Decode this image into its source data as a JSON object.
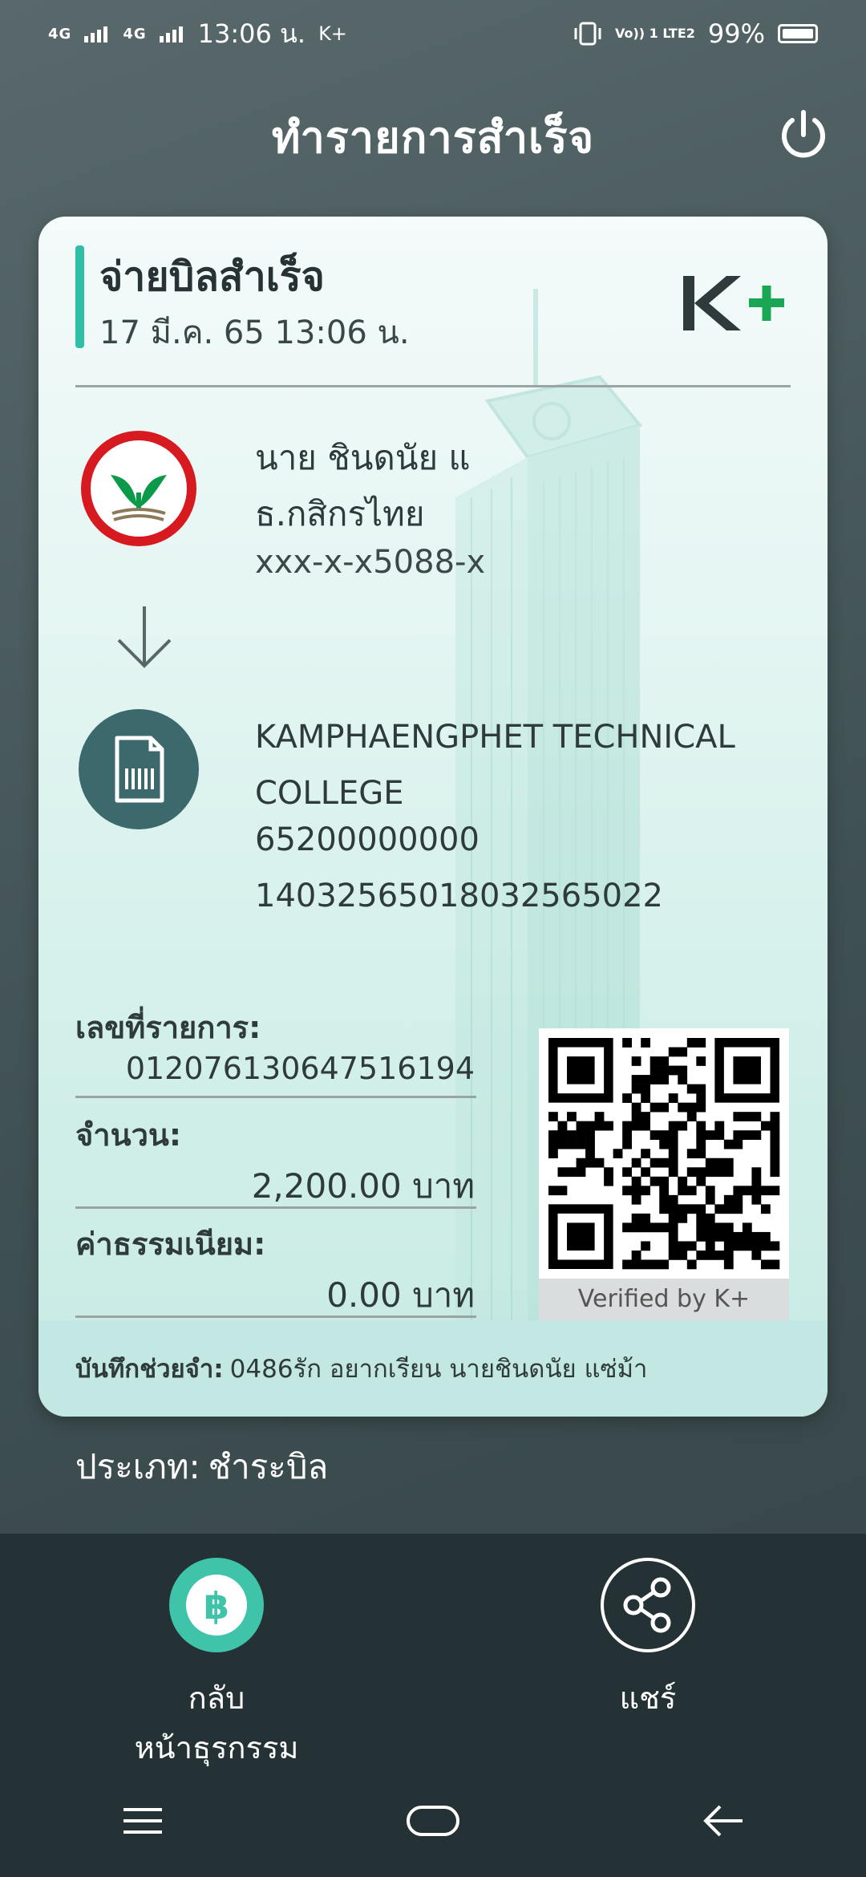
{
  "status_bar": {
    "signal_1": "4G",
    "signal_2": "4G",
    "time": "13:06 น.",
    "app_tag": "K+",
    "lte_label": "Vo)) 1 LTE2",
    "battery": "99%"
  },
  "header": {
    "title": "ทำรายการสำเร็จ"
  },
  "card": {
    "title": "จ่ายบิลสำเร็จ",
    "datetime": "17 มี.ค. 65  13:06 น.",
    "from": {
      "name": "นาย ชินดนัย แ",
      "bank": "ธ.กสิกรไทย",
      "account": "xxx-x-x5088-x"
    },
    "to": {
      "name": "KAMPHAENGPHET TECHNICAL COLLEGE",
      "ref1": "65200000000",
      "ref2": "14032565018032565022"
    },
    "transaction": {
      "ref_label": "เลขที่รายการ:",
      "ref_value": "012076130647516194",
      "amount_label": "จำนวน:",
      "amount_value": "2,200.00 บาท",
      "fee_label": "ค่าธรรมเนียม:",
      "fee_value": "0.00 บาท"
    },
    "qr_caption": "Verified by K+",
    "memo_label": "บันทึกช่วยจำ:",
    "memo_value": "0486รัก อยากเรียน นายชินดนัย แซ่ม้า"
  },
  "type": {
    "label": "ประเภท:",
    "value": "ชำระบิล"
  },
  "actions": {
    "back_label_1": "กลับ",
    "back_label_2": "หน้าธุรกรรม",
    "share_label": "แชร์"
  },
  "colors": {
    "accent": "#2fbfa6",
    "kbank_green": "#0a9a4a",
    "kbank_red": "#d71920",
    "bill_icon_bg": "#3c6a6c"
  }
}
